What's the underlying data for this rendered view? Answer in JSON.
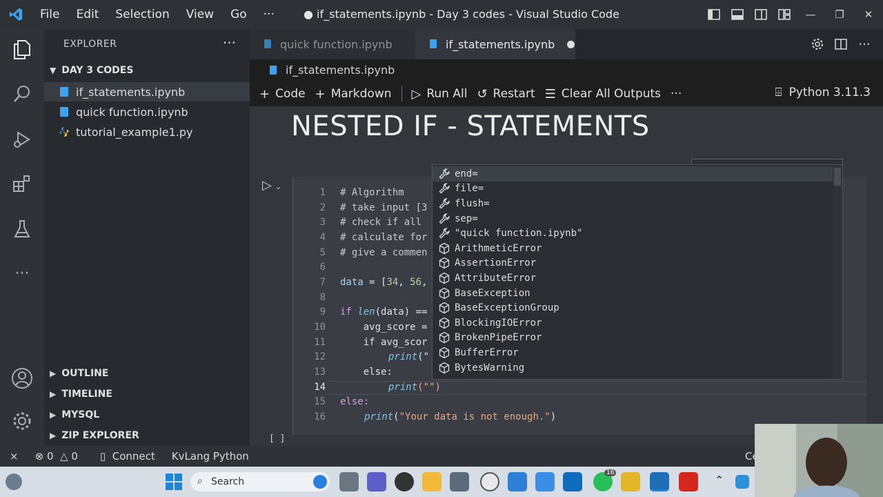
{
  "titlebar": {
    "menu": [
      "File",
      "Edit",
      "Selection",
      "View",
      "Go",
      "···"
    ],
    "window_title": "● if_statements.ipynb - Day 3 codes - Visual Studio Code"
  },
  "sidebar": {
    "header": "EXPLORER",
    "folder": "DAY 3 CODES",
    "files": [
      {
        "name": "if_statements.ipynb",
        "active": true
      },
      {
        "name": "quick function.ipynb",
        "active": false
      },
      {
        "name": "tutorial_example1.py",
        "active": false
      }
    ],
    "sections": [
      "OUTLINE",
      "TIMELINE",
      "MYSQL",
      "ZIP EXPLORER"
    ]
  },
  "tabs": [
    {
      "label": "quick function.ipynb"
    },
    {
      "label": "if_statements.ipynb"
    }
  ],
  "breadcrumb": "if_statements.ipynb",
  "toolbar": {
    "code": "Code",
    "markdown": "Markdown",
    "run_all": "Run All",
    "restart": "Restart",
    "clear": "Clear All Outputs",
    "more": "···",
    "kernel": "Python 3.11.3"
  },
  "markdown_title": "NESTED IF - STATEMENTS",
  "code": {
    "line_numbers": [
      "1",
      "2",
      "3",
      "4",
      "5",
      "6",
      "7",
      "8",
      "9",
      "10",
      "11",
      "12",
      "13",
      "14",
      "15",
      "16"
    ],
    "l1": "# Algorithm",
    "l2": "# take input [3",
    "l3": "# check if all",
    "l4": "# calculate for",
    "l5": "# give a commen",
    "l7a": "data",
    "l7b": " = [",
    "l7c": "34",
    "l7d": ", ",
    "l7e": "56",
    "l7f": ",",
    "l9a": "if ",
    "l9b": "len",
    "l9c": "(data) ==",
    "l10": "    avg_score =",
    "l11": "    if avg_scor",
    "l12a": "print",
    "l12b": "(\"",
    "l13": "    else:",
    "l14a": "print",
    "l14b": "(\"\")",
    "l15": "else:",
    "l16a": "print",
    "l16b": "(",
    "l16c": "\"Your data is not enough.\"",
    "l16d": ")",
    "cell_bracket": "[ ]"
  },
  "suggestions": [
    {
      "label": "end=",
      "kind": "wrench"
    },
    {
      "label": "file=",
      "kind": "wrench"
    },
    {
      "label": "flush=",
      "kind": "wrench"
    },
    {
      "label": "sep=",
      "kind": "wrench"
    },
    {
      "label": "\"quick function.ipynb\"",
      "kind": "wrench"
    },
    {
      "label": "ArithmeticError",
      "kind": "class"
    },
    {
      "label": "AssertionError",
      "kind": "class"
    },
    {
      "label": "AttributeError",
      "kind": "class"
    },
    {
      "label": "BaseException",
      "kind": "class"
    },
    {
      "label": "BaseExceptionGroup",
      "kind": "class"
    },
    {
      "label": "BlockingIOError",
      "kind": "class"
    },
    {
      "label": "BrokenPipeError",
      "kind": "class"
    },
    {
      "label": "BufferError",
      "kind": "class"
    },
    {
      "label": "BytesWarning",
      "kind": "class"
    }
  ],
  "status": {
    "errors": "0",
    "warnings": "0",
    "connect": "Connect",
    "language": "KvLang Python",
    "cell": "Cell"
  },
  "taskbar": {
    "search": "Search",
    "badge": "16"
  },
  "colors": {
    "titlebar": "#2e3136",
    "sidebar": "#272a2f",
    "editor": "#33373c",
    "accent_blue": "#3ea2f2"
  }
}
